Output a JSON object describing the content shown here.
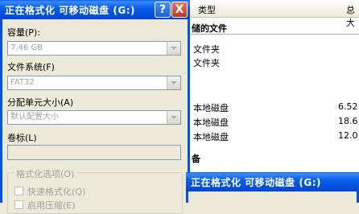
{
  "format_dialog": {
    "title": "正在格式化  可移动磁盘  (G:)",
    "help_label": "?",
    "close_label": "X",
    "capacity_label": "容量(P):",
    "capacity_value": "7.46 GB",
    "filesystem_label": "文件系统(F)",
    "filesystem_value": "FAT32",
    "allocation_label": "分配单元大小(A)",
    "allocation_value": "默认配置大小",
    "volume_label": "卷标(L)",
    "options_group": "格式化选项(O)",
    "quick_format_label": "快速格式化(Q)",
    "compression_label": "启用压缩(E)"
  },
  "explorer": {
    "column_type": "类型",
    "column_total": "总大",
    "group_files": "储的文件",
    "rows": [
      {
        "type": "文件夹",
        "size": ""
      },
      {
        "type": "文件夹",
        "size": ""
      },
      {
        "type": "本地磁盘",
        "size": "6.52"
      },
      {
        "type": "本地磁盘",
        "size": "18.6"
      },
      {
        "type": "本地磁盘",
        "size": "12.0"
      }
    ],
    "group_devices": "备"
  },
  "second_dialog": {
    "title": "正在格式化  可移动磁盘  (G:)"
  }
}
